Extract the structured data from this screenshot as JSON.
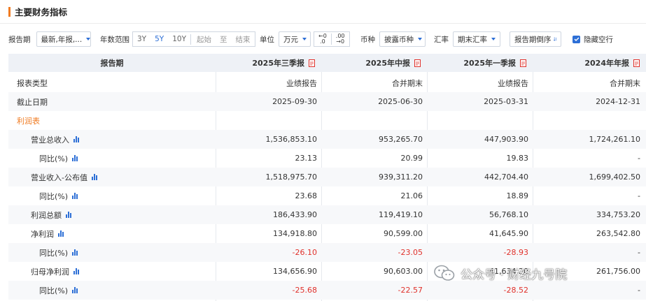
{
  "section": {
    "title": "主要财务指标"
  },
  "toolbar": {
    "period_label": "报告期",
    "period_value": "最新,年报,...",
    "years_label": "年数范围",
    "years_options": [
      "3Y",
      "5Y",
      "10Y"
    ],
    "years_selected": "5Y",
    "range_start": "起始",
    "range_sep": "至",
    "range_end": "结束",
    "unit_label": "单位",
    "unit_value": "万元",
    "decimal_left": "←0",
    "decimal_left_sub": ".0",
    "decimal_right": ".00",
    "decimal_right_sub": "→0",
    "currency_label": "币种",
    "currency_value": "披露币种",
    "rate_label": "汇率",
    "rate_value": "期末汇率",
    "order_label": "报告期倒序",
    "hide_empty_label": "隐藏空行",
    "hide_empty_checked": true
  },
  "table": {
    "header": [
      "报告期",
      "2025年三季报",
      "2025年中报",
      "2025年一季报",
      "2024年年报"
    ],
    "rows": [
      {
        "label": "报表类型",
        "values": [
          "业绩报告",
          "合并期末",
          "业绩报告",
          "合并期末"
        ]
      },
      {
        "label": "截止日期",
        "values": [
          "2025-09-30",
          "2025-06-30",
          "2025-03-31",
          "2024-12-31"
        ]
      },
      {
        "label": "利润表",
        "values": [
          "",
          "",
          "",
          ""
        ]
      },
      {
        "label": "营业总收入",
        "values": [
          "1,536,853.10",
          "953,265.70",
          "447,903.90",
          "1,724,261.10"
        ]
      },
      {
        "label": "同比(%)",
        "values": [
          "23.13",
          "20.99",
          "19.83",
          "-"
        ]
      },
      {
        "label": "营业收入-公布值",
        "values": [
          "1,518,975.70",
          "939,311.20",
          "442,704.40",
          "1,699,402.50"
        ]
      },
      {
        "label": "同比(%)",
        "values": [
          "23.68",
          "21.06",
          "18.89",
          "-"
        ]
      },
      {
        "label": "利润总额",
        "values": [
          "186,433.90",
          "119,419.10",
          "56,768.10",
          "334,753.20"
        ]
      },
      {
        "label": "净利润",
        "values": [
          "134,918.80",
          "90,599.00",
          "41,645.90",
          "263,542.80"
        ]
      },
      {
        "label": "同比(%)",
        "values": [
          "-26.10",
          "-23.05",
          "-28.93",
          "-"
        ]
      },
      {
        "label": "归母净利润",
        "values": [
          "134,656.90",
          "90,603.00",
          "41,634.20",
          "261,756.00"
        ]
      },
      {
        "label": "同比(%)",
        "values": [
          "-25.68",
          "-22.57",
          "-28.52",
          "-"
        ]
      }
    ]
  },
  "watermark": {
    "text": "公众号 · 财经九号院"
  },
  "colors": {
    "accent": "#f07b21",
    "link": "#2d6fd6",
    "negative": "#e0312b",
    "header_bg": "#eef1f6"
  }
}
